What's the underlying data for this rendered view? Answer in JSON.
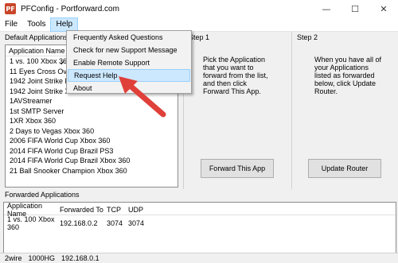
{
  "window": {
    "title": "PFConfig - Portforward.com",
    "icon_name": "pfconfig-app-icon",
    "icon_glyph": "PF",
    "minimize": "—",
    "maximize": "☐",
    "close": "✕"
  },
  "menu": {
    "items": [
      {
        "label": "File"
      },
      {
        "label": "Tools"
      },
      {
        "label": "Help"
      }
    ],
    "active": "Help"
  },
  "help_menu": {
    "items": [
      {
        "label": "Frequently Asked Questions",
        "checked": false,
        "highlighted": false
      },
      {
        "label": "Check for new Support Message",
        "checked": false,
        "highlighted": false
      },
      {
        "label": "Enable Remote Support",
        "checked": true,
        "highlighted": false
      },
      {
        "label": "Request Help",
        "checked": false,
        "highlighted": true
      },
      {
        "label": "About",
        "checked": false,
        "highlighted": false
      }
    ],
    "check_glyph": "✓"
  },
  "default_apps": {
    "group_label": "Default Applications",
    "column_header": "Application Name",
    "rows": [
      "1 vs. 100 Xbox 360",
      "11 Eyes Cross Over",
      "1942 Joint Strike PS3",
      "1942 Joint Strike Xbox 360",
      "1AVStreamer",
      "1st SMTP Server",
      "1XR Xbox 360",
      "2 Days to Vegas Xbox 360",
      "2006 FIFA World Cup Xbox 360",
      "2014 FIFA World Cup Brazil PS3",
      "2014 FIFA World Cup Brazil Xbox 360",
      "21 Ball Snooker Champion Xbox 360"
    ]
  },
  "step1": {
    "title": "Step 1",
    "text": "Pick the Application that you want to forward from the list, and then click Forward This App.",
    "button": "Forward This App"
  },
  "step2": {
    "title": "Step 2",
    "text": "When you have all of your Applications listed as forwarded below, click Update Router.",
    "button": "Update Router"
  },
  "forwarded": {
    "section_label": "Forwarded Applications",
    "headers": [
      "Application Name",
      "Forwarded To",
      "TCP",
      "UDP"
    ],
    "rows": [
      [
        "1 vs. 100 Xbox 360",
        "192.168.0.2",
        "3074",
        "3074"
      ]
    ]
  },
  "status": {
    "router": "2wire",
    "model": "1000HG",
    "ip": "192.168.0.1"
  },
  "colors": {
    "highlight": "#cce8ff",
    "arrow": "#e0403a",
    "app_icon": "#c8462a"
  }
}
